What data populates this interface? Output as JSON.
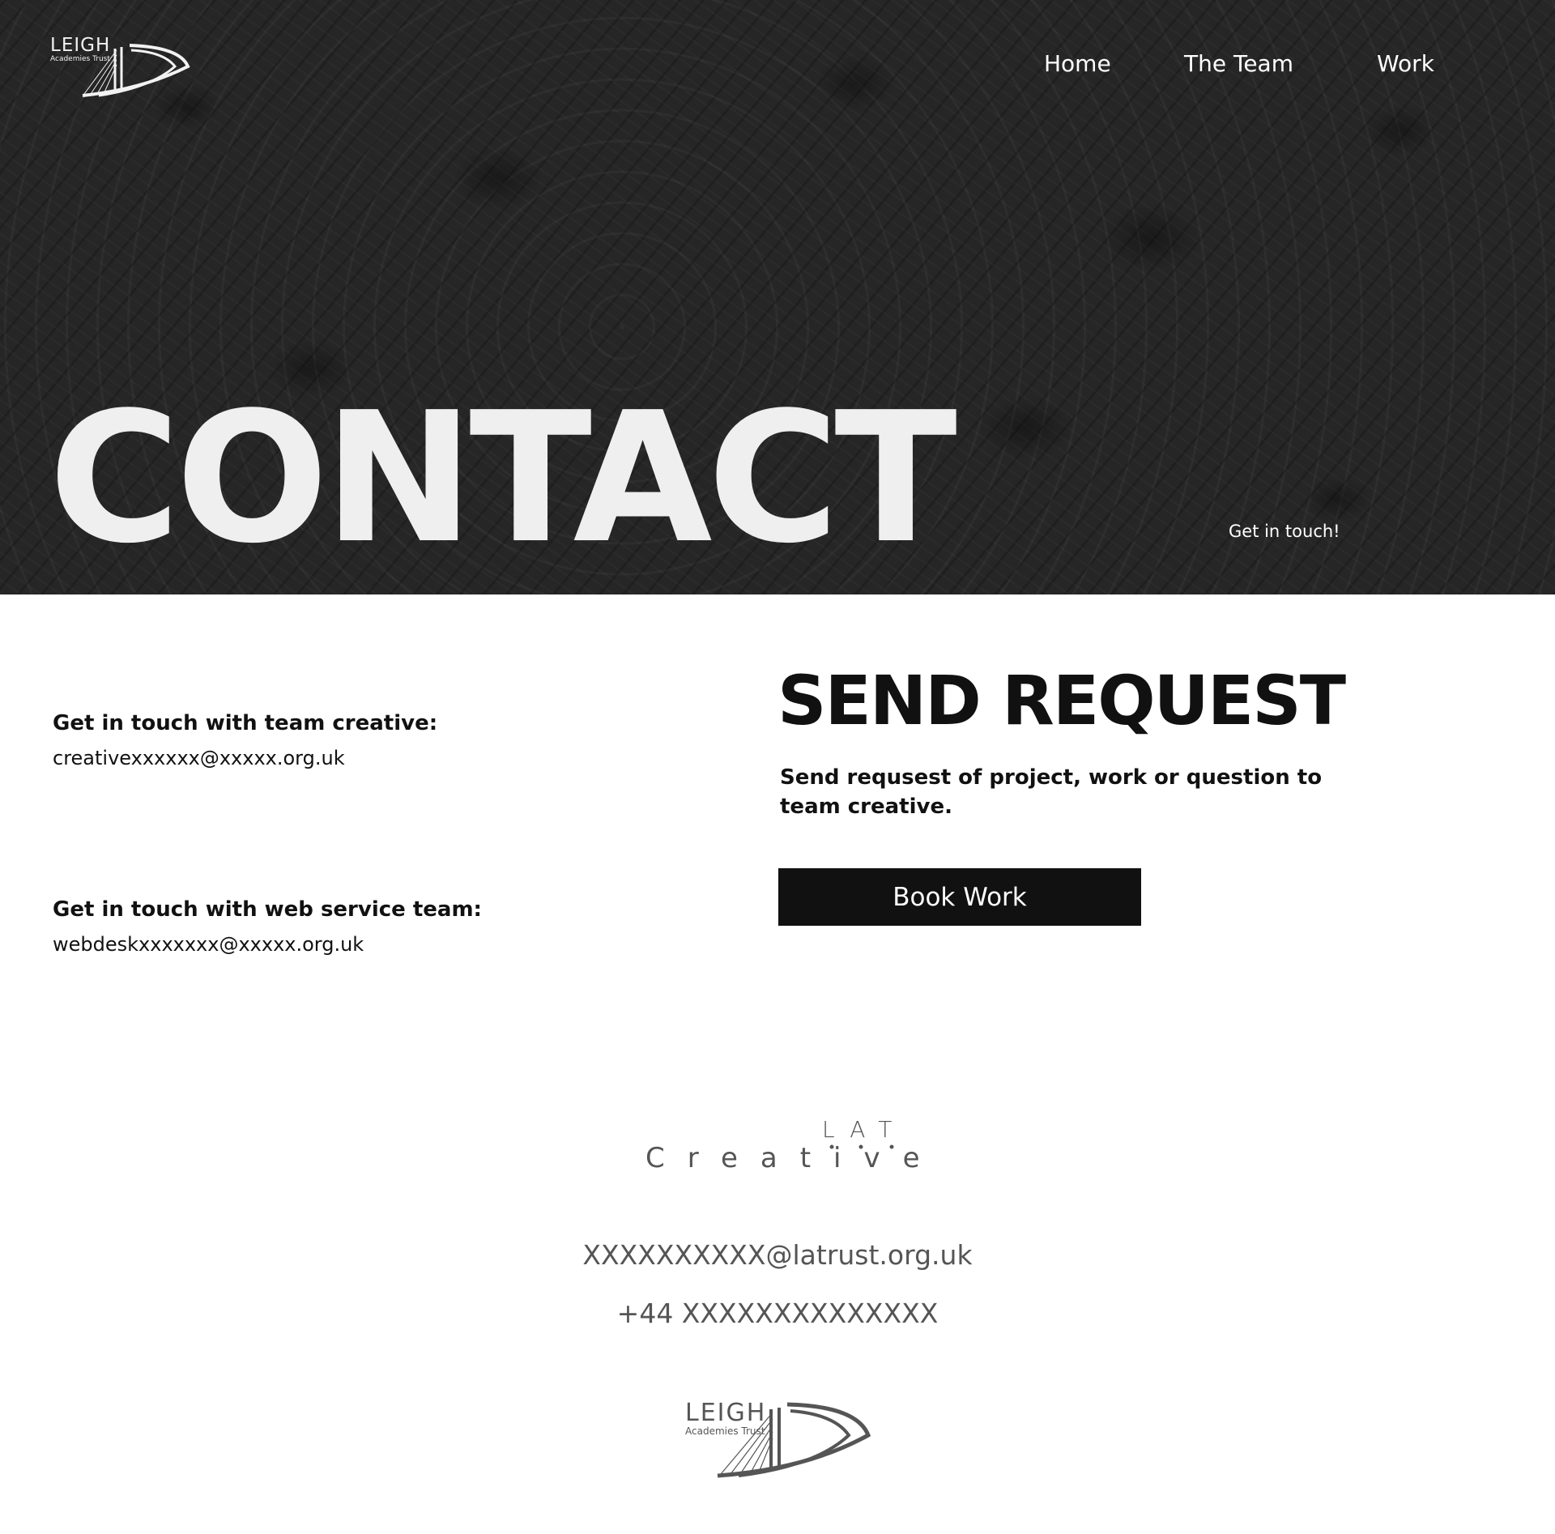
{
  "header": {
    "logo": {
      "name": "LEIGH",
      "tagline": "Academies Trust"
    },
    "nav": [
      {
        "label": "Home"
      },
      {
        "label": "The Team"
      },
      {
        "label": "Work"
      }
    ]
  },
  "hero": {
    "title": "CONTACT",
    "subtitle": "Get in touch!"
  },
  "contacts": [
    {
      "label": "Get in touch with team creative:",
      "email": "creativexxxxxx@xxxxx.org.uk"
    },
    {
      "label": "Get in touch with web service team:",
      "email": "webdeskxxxxxxx@xxxxx.org.uk"
    }
  ],
  "request": {
    "title": "SEND REQUEST",
    "description": "Send requsest of project, work or question to team creative.",
    "button_label": "Book Work"
  },
  "footer": {
    "brand_top": "LAT",
    "brand_bottom": "Creative",
    "email": "XXXXXXXXXX@latrust.org.uk",
    "phone": "+44 XXXXXXXXXXXXXX",
    "logo": {
      "name": "LEIGH",
      "tagline": "Academies Trust"
    }
  },
  "colors": {
    "hero_bg": "#262626",
    "text_dark": "#111111",
    "footer_text": "#555555",
    "button_bg": "#111111"
  }
}
